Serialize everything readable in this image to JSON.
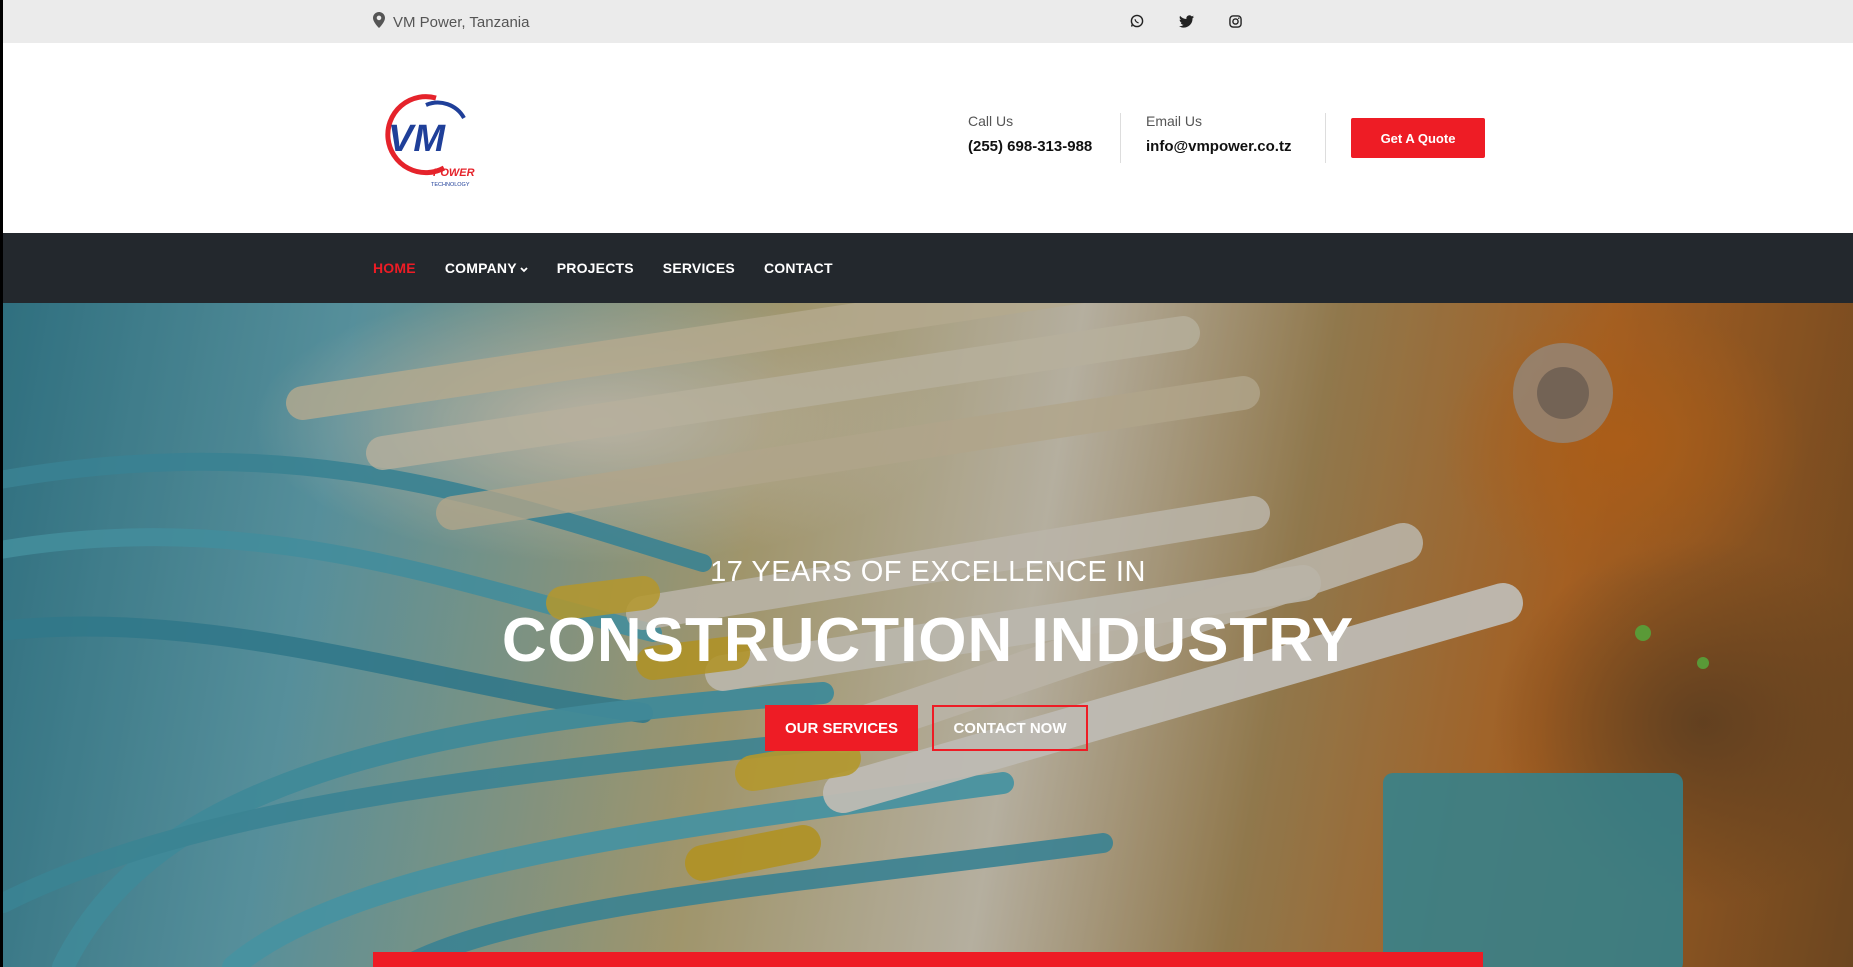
{
  "topbar": {
    "location": "VM Power, Tanzania",
    "socials": [
      "whatsapp-icon",
      "twitter-icon",
      "instagram-icon"
    ]
  },
  "header": {
    "logo": {
      "main": "VM",
      "sub1": "POWER",
      "sub2": "TECHNOLOGY"
    },
    "call_label": "Call Us",
    "call_value": "(255) 698-313-988",
    "email_label": "Email Us",
    "email_value": "info@vmpower.co.tz",
    "quote_button": "Get A Quote"
  },
  "nav": {
    "items": [
      {
        "label": "HOME",
        "active": true
      },
      {
        "label": "COMPANY",
        "dropdown": true
      },
      {
        "label": "PROJECTS"
      },
      {
        "label": "SERVICES"
      },
      {
        "label": "CONTACT"
      }
    ]
  },
  "hero": {
    "subtitle": "17 YEARS OF EXCELLENCE IN",
    "title": "CONSTRUCTION INDUSTRY",
    "primary_button": "OUR SERVICES",
    "secondary_button": "CONTACT NOW"
  },
  "colors": {
    "accent": "#ee1c25",
    "nav_bg": "#23282d",
    "topbar_bg": "#ebebeb",
    "logo_blue": "#1f3f99"
  }
}
